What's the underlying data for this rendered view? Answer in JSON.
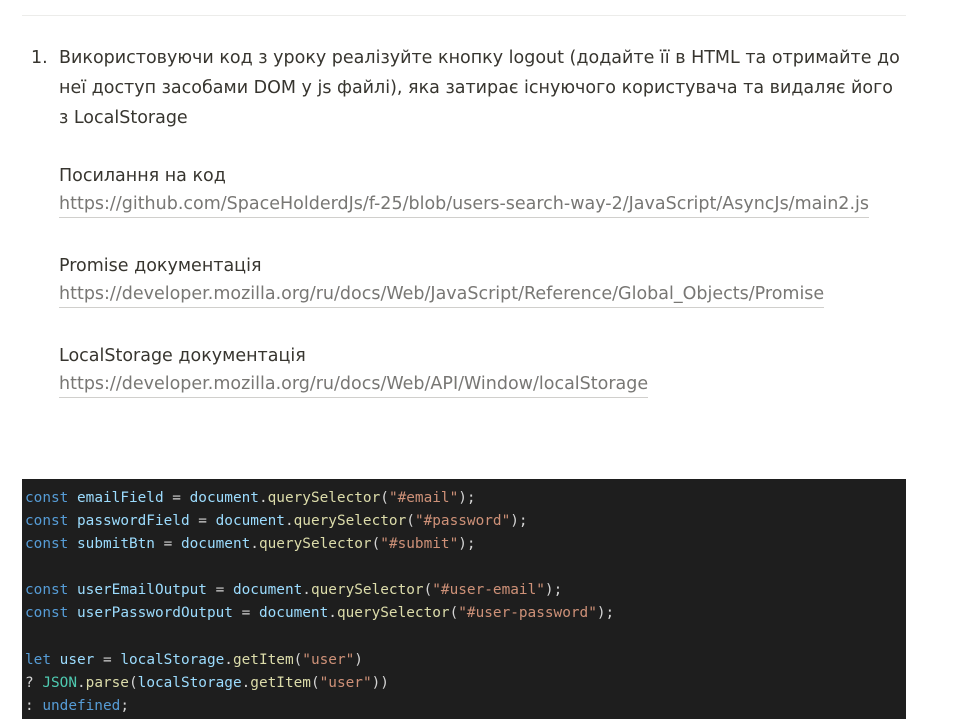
{
  "task": {
    "number": "1.",
    "text": "Використовуючи код з уроку реалізуйте кнопку logout (додайте її в HTML та отримайте до неї доступ засобами DOM у js файлі), яка затирає існуючого користувача та видаляє його з LocalStorage"
  },
  "references": [
    {
      "label": "Посилання на код",
      "url": "https://github.com/SpaceHolderdJs/f-25/blob/users-search-way-2/JavaScript/AsyncJs/main2.js"
    },
    {
      "label": "Promise документація",
      "url": "https://developer.mozilla.org/ru/docs/Web/JavaScript/Reference/Global_Objects/Promise"
    },
    {
      "label": "LocalStorage документація",
      "url": "https://developer.mozilla.org/ru/docs/Web/API/Window/localStorage"
    }
  ],
  "code": {
    "kw_const": "const",
    "kw_let": "let",
    "kw_undefined": "undefined",
    "id_document": "document",
    "id_localStorage": "localStorage",
    "id_JSON": "JSON",
    "fn_querySelector": "querySelector",
    "fn_getItem": "getItem",
    "fn_parse": "parse",
    "var_emailField": "emailField",
    "var_passwordField": "passwordField",
    "var_submitBtn": "submitBtn",
    "var_userEmailOutput": "userEmailOutput",
    "var_userPasswordOutput": "userPasswordOutput",
    "var_user": "user",
    "str_email": "\"#email\"",
    "str_password": "\"#password\"",
    "str_submit": "\"#submit\"",
    "str_user_email": "\"#user-email\"",
    "str_user_password": "\"#user-password\"",
    "str_user": "\"user\""
  }
}
